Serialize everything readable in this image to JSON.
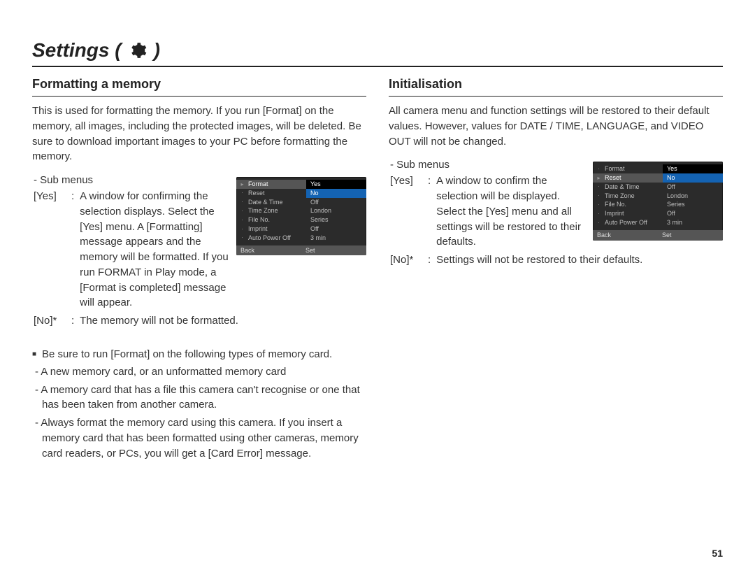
{
  "page_title_prefix": "Settings (",
  "page_title_suffix": ")",
  "page_number": "51",
  "left": {
    "heading": "Formatting a memory",
    "intro": "This is used for formatting the memory. If you run [Format] on the memory, all images, including the protected images, will be deleted. Be sure to download important images to your PC before formatting the memory.",
    "sub_label": "- Sub menus",
    "yes_key": "[Yes]",
    "colon": ":",
    "yes_desc": "A window for confirming the selection displays. Select the [Yes] menu. A [Formatting] message appears and the memory will be formatted. If you run FORMAT in Play mode, a [Format is completed] message will appear.",
    "no_key": "[No]*",
    "no_desc": "The memory will not be formatted.",
    "note_head": "Be sure to run [Format] on the following types of memory card.",
    "notes": [
      "A new memory card, or an unformatted memory card",
      "A memory card that has a file this camera can't recognise or one that has been taken from another camera.",
      "Always format the memory card using this camera. If you insert a memory card that has been formatted using other cameras, memory card readers, or PCs, you will get a [Card Error] message."
    ],
    "menu": {
      "left_items": [
        "Format",
        "Reset",
        "Date & Time",
        "Time Zone",
        "File No.",
        "Imprint",
        "Auto Power Off"
      ],
      "selected_index": 0,
      "right_yes": "Yes",
      "right_no": "No",
      "right_rest": [
        "Off",
        "London",
        "Series",
        "Off",
        "3 min"
      ],
      "foot_left": "Back",
      "foot_right": "Set"
    }
  },
  "right": {
    "heading": "Initialisation",
    "intro": "All camera menu and function settings will be restored to their default values. However, values for DATE / TIME, LANGUAGE, and VIDEO OUT will not be changed.",
    "sub_label": "- Sub menus",
    "yes_key": "[Yes]",
    "colon": ":",
    "yes_desc": "A window to confirm the selection will be displayed. Select the [Yes] menu and all settings will be restored to their defaults.",
    "no_key": "[No]*",
    "no_desc": "Settings will not be restored to their defaults.",
    "menu": {
      "left_items": [
        "Format",
        "Reset",
        "Date & Time",
        "Time Zone",
        "File No.",
        "Imprint",
        "Auto Power Off"
      ],
      "selected_index": 1,
      "right_yes": "Yes",
      "right_no": "No",
      "right_rest": [
        "Off",
        "London",
        "Series",
        "Off",
        "3 min"
      ],
      "foot_left": "Back",
      "foot_right": "Set"
    }
  }
}
